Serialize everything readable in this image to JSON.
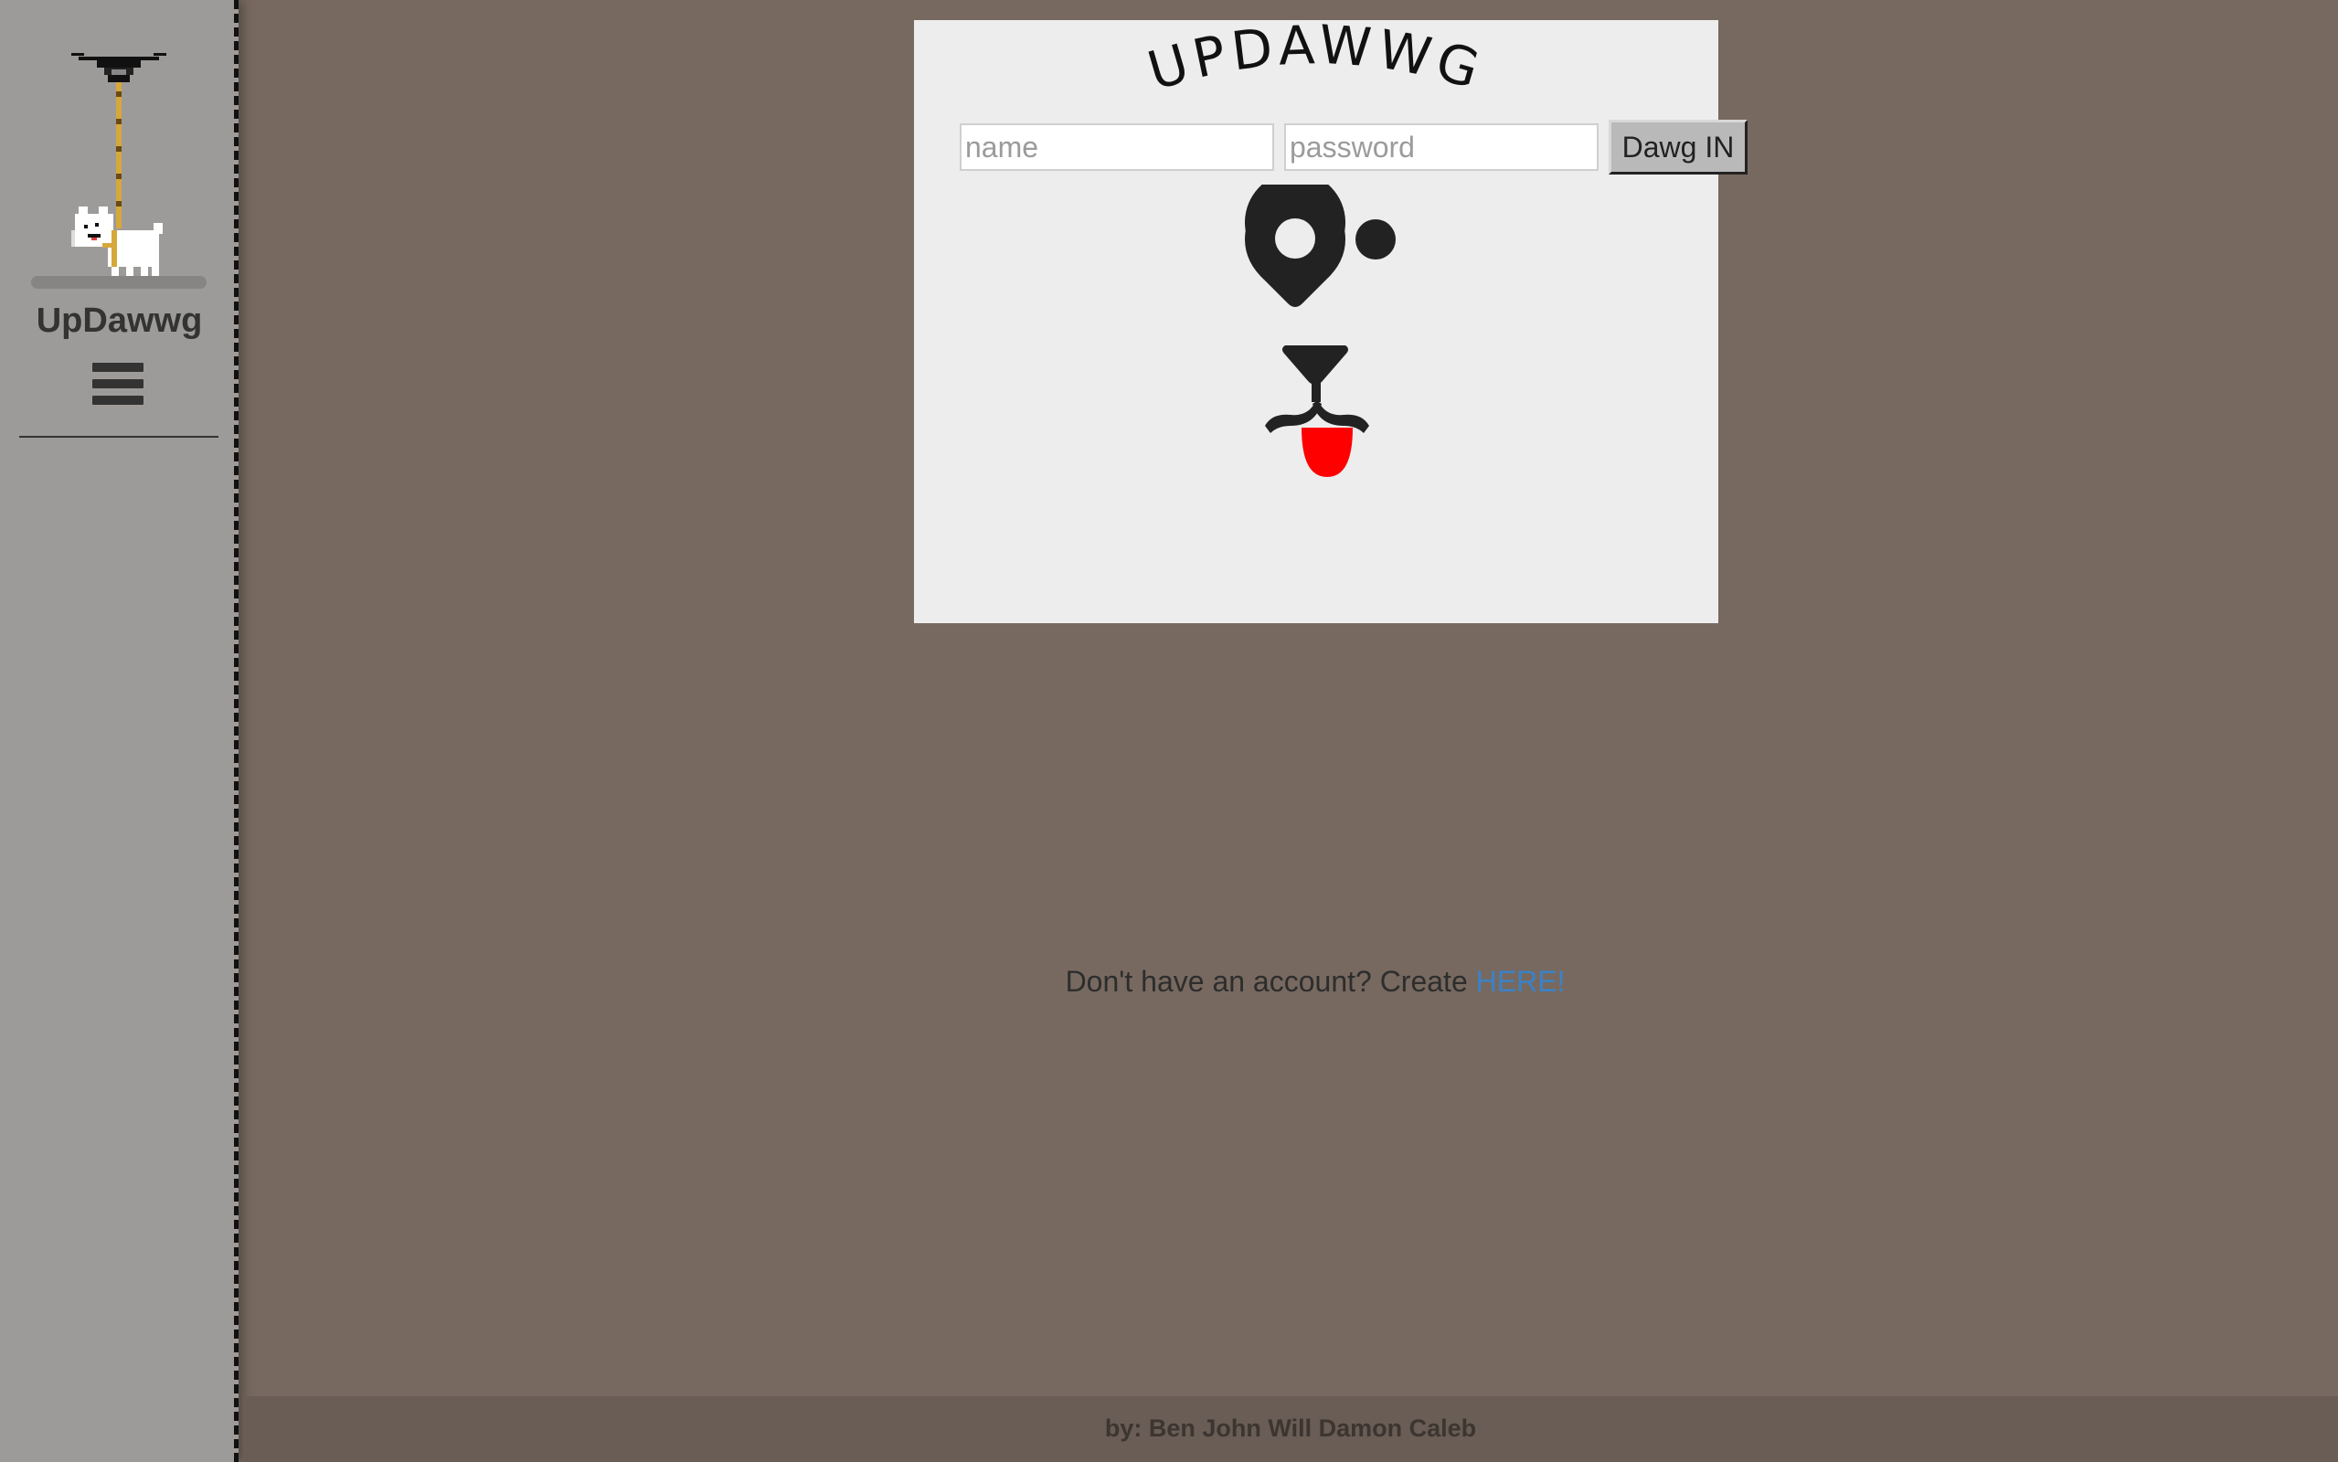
{
  "sidebar": {
    "brand": "UpDawwg",
    "menu_icon": "hamburger-menu-icon",
    "logo_icon": "drone-carrying-dog-icon",
    "background": "#9d9b99"
  },
  "login": {
    "title": "UPDAWWG",
    "name_placeholder": "name",
    "password_placeholder": "password",
    "submit_label": "Dawg IN"
  },
  "signup": {
    "prompt": "Don't have an account? Create ",
    "link_label": "HERE!",
    "link_color": "#3a82c8"
  },
  "footer": {
    "credits": "by: Ben John Will Damon Caleb"
  },
  "colors": {
    "page_background": "#77695f",
    "card_background": "#ededed",
    "tongue": "#ff0000"
  }
}
